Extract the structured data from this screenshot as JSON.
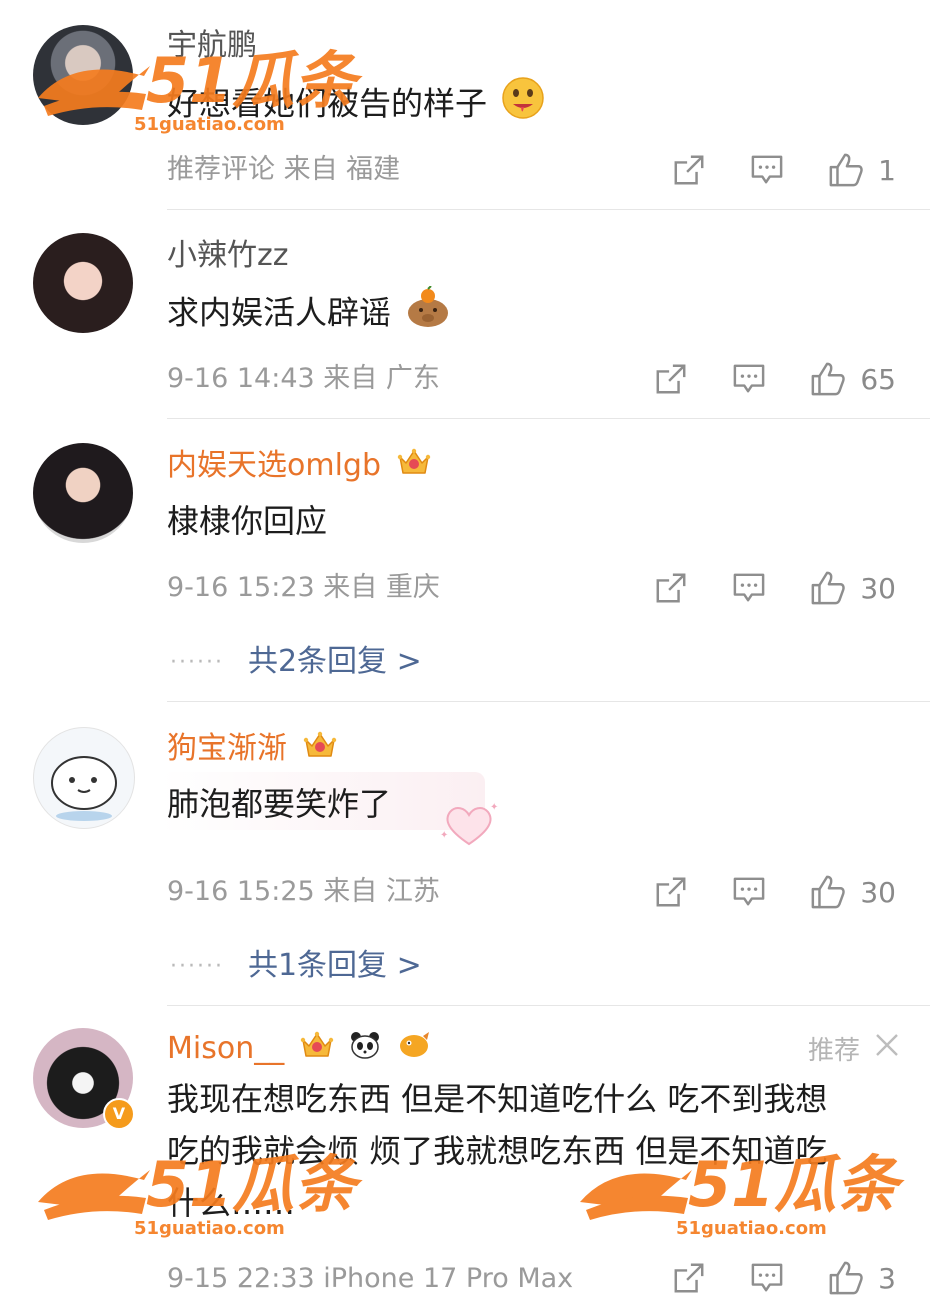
{
  "comments": [
    {
      "username": "宇航鹏",
      "text": "好想看她们被告的样子",
      "emoji": "drooling-face",
      "meta": "推荐评论 来自 福建",
      "likes": "1"
    },
    {
      "username": "小辣竹zz",
      "text": "求内娱活人辟谣",
      "emoji": "capybara-orange",
      "meta": "9-16 14:43 来自 广东",
      "likes": "65"
    },
    {
      "username": "内娱天选omlgb",
      "badge_level": "7",
      "text": "棣棣你回应",
      "meta": "9-16 15:23 来自 重庆",
      "likes": "30",
      "replies": "共2条回复 >"
    },
    {
      "username": "狗宝渐渐",
      "badge_level": "6",
      "text": "肺泡都要笑炸了",
      "meta": "9-16 15:25 来自 江苏",
      "likes": "30",
      "replies": "共1条回复 >"
    },
    {
      "username": "Mison__",
      "badge_level": "4",
      "text_lines": [
        "我现在想吃东西 但是不知道吃什么 吃不到我想",
        "吃的我就会烦 烦了我就想吃东西 但是不知道吃",
        "什么……"
      ],
      "meta": "9-15 22:33 iPhone 17 Pro Max",
      "likes": "3",
      "recommend_label": "推荐"
    }
  ],
  "dots": "······",
  "watermark": {
    "brand": "51瓜条",
    "url": "51guatiao.com"
  },
  "colors": {
    "orange": "#e8742a",
    "link": "#4e6894",
    "meta": "#9a9a9a",
    "watermark": "#f57c1f"
  }
}
